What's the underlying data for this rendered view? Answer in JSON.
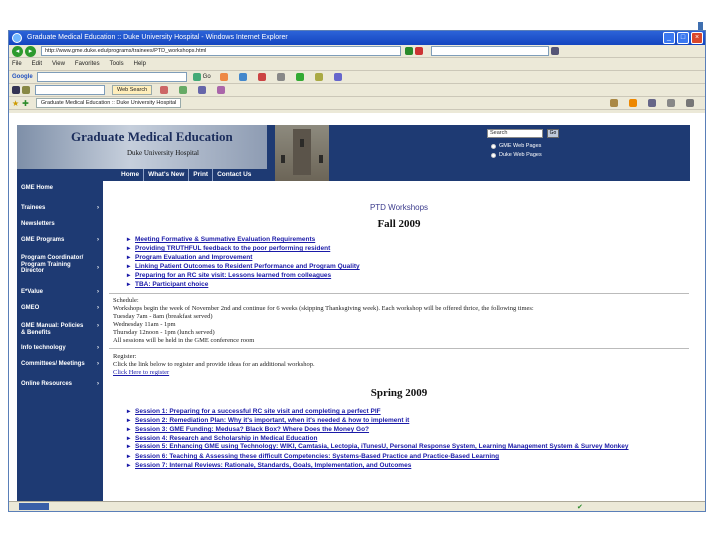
{
  "browser": {
    "title": "Graduate Medical Education :: Duke University Hospital - Windows Internet Explorer",
    "address": "http://www.gme.duke.edu/programs/trainees/PTD_workshops.html",
    "tab_label": "Graduate Medical Education :: Duke University Hospital",
    "toolbar_search_placeholder": "Web Search",
    "google_label": "Google",
    "menu": [
      "File",
      "Edit",
      "View",
      "Favorites",
      "Tools",
      "Help"
    ]
  },
  "site": {
    "title": "Graduate Medical Education",
    "subtitle": "Duke University Hospital",
    "nav": [
      "Home",
      "What's New",
      "Print",
      "Contact Us"
    ],
    "search_value": "Search",
    "go_label": "Go",
    "radio_1": "GME Web Pages",
    "radio_2": "Duke Web Pages"
  },
  "sidebar": {
    "items": [
      {
        "label": "GME Home"
      },
      {
        "label": "Trainees"
      },
      {
        "label": "Newsletters"
      },
      {
        "label": "GME Programs"
      },
      {
        "label": "Program Coordinator/ Program Training Director"
      },
      {
        "label": "E*Value"
      },
      {
        "label": "GMEO"
      },
      {
        "label": "GME Manual: Policies & Benefits"
      },
      {
        "label": "Info technology"
      },
      {
        "label": "Committees/ Meetings"
      },
      {
        "label": "Online Resources"
      }
    ]
  },
  "main": {
    "page_heading": "PTD Workshops",
    "fall_heading": "Fall 2009",
    "fall_items": [
      "Meeting Formative & Summative Evaluation Requirements",
      "Providing TRUTHFUL feedback to the poor performing resident",
      "Program Evaluation and Improvement",
      "Linking Patient Outcomes to Resident Performance and Program Quality",
      "Preparing for an RC site visit: Lessons learned from colleagues",
      "TBA: Participant choice"
    ],
    "schedule_lines": [
      "Schedule:",
      "Workshops begin the week of November 2nd and continue for 6 weeks (skipping Thanksgiving week). Each workshop will be offered thrice, the following times:",
      "Tuesday 7am - 8am (breakfast served)",
      "Wednesday 11am - 1pm",
      "Thursday 12noon - 1pm (lunch served)",
      "All sessions will be held in the GME conference room"
    ],
    "register_lines": [
      "Register:",
      "Click the link below to register and provide ideas for an additional workshop."
    ],
    "register_link": "Click Here to register",
    "spring_heading": "Spring 2009",
    "spring_items": [
      "Session 1: Preparing for a successful RC site visit and completing a perfect PIF",
      "Session 2: Remediation Plan: Why it's important, when it's needed & how to implement it",
      "Session 3: GME Funding: Medusa? Black Box? Where Does the Money Go?",
      "Session 4: Research and Scholarship in Medical Education",
      "Session 5: Enhancing GME using Technology: WIKI, Camtasia, Lectopia, iTunesU, Personal Response System, Learning Management System & Survey Monkey",
      "Session 6: Teaching & Assessing these difficult Competencies: Systems-Based Practice and Practice-Based Learning",
      "Session 7: Internal Reviews: Rationale, Standards, Goals, Implementation, and Outcomes"
    ]
  },
  "colors": {
    "site_navy": "#1e3a73",
    "link_blue": "#1a1aa8",
    "ie_titlebar": "#1445c0"
  }
}
